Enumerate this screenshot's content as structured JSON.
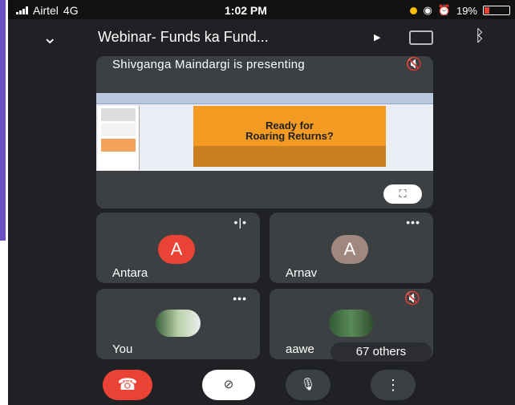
{
  "status": {
    "carrier": "Airtel",
    "network": "4G",
    "time": "1:02 PM",
    "battery": "19%"
  },
  "header": {
    "title": "Webinar- Funds ka Fund...",
    "back_icon": "chevron-down-icon",
    "play_icon": "play-icon",
    "camera_icon": "camera-switch-icon",
    "bluetooth_icon": "bluetooth-icon"
  },
  "presentation": {
    "label": "Shivganga Maindargi is presenting",
    "slide_title": [
      "Ready for",
      "Roaring Returns?"
    ],
    "fullscreen_icon": "fullscreen-icon"
  },
  "participants": [
    {
      "name": "Antara",
      "initial": "A",
      "color": "#ea4335",
      "menu": "•|•"
    },
    {
      "name": "Arnav",
      "initial": "A",
      "color": "#a1887f",
      "menu": "•••"
    },
    {
      "name": "You",
      "menu": "•••"
    },
    {
      "name": "aawe"
    }
  ],
  "others": "67 others",
  "controls": {
    "end": "end-call-icon",
    "video": "video-off-icon",
    "mic": "microphone-icon",
    "more": "more-vert-icon"
  }
}
